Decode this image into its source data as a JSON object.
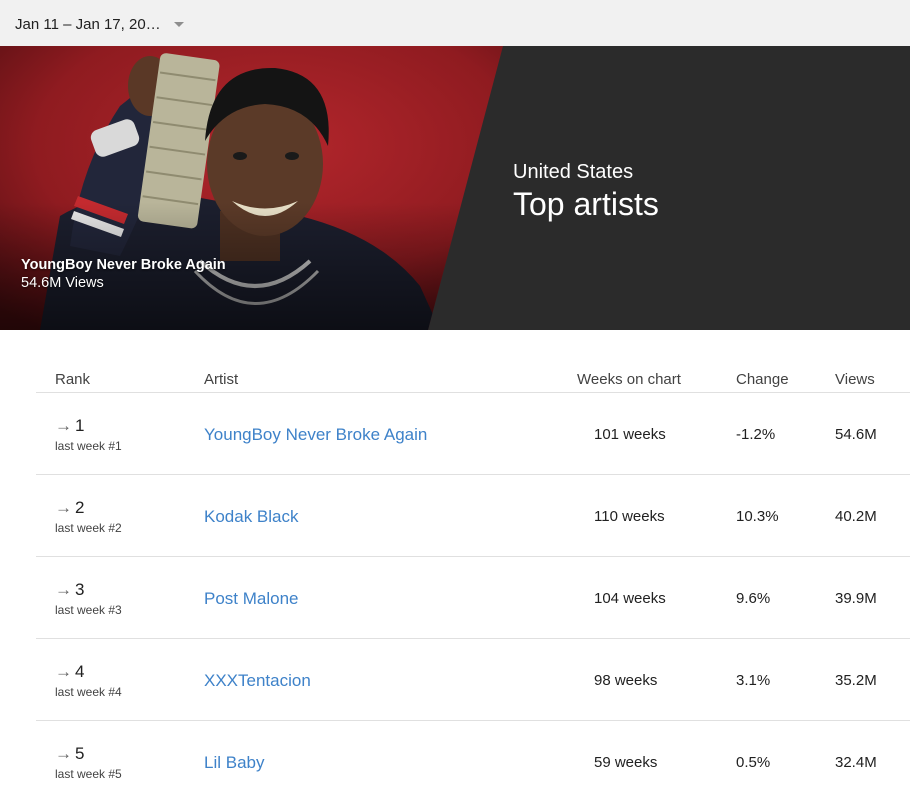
{
  "date_range": {
    "label": "Jan 11 – Jan 17, 20…"
  },
  "hero": {
    "artist": "YoungBoy Never Broke Again",
    "views": "54.6M Views",
    "country": "United States",
    "heading": "Top artists"
  },
  "columns": {
    "rank": "Rank",
    "artist": "Artist",
    "weeks": "Weeks on chart",
    "change": "Change",
    "views": "Views"
  },
  "rows": [
    {
      "arrow": "→",
      "rank": "1",
      "last_week": "last week #1",
      "artist": "YoungBoy Never Broke Again",
      "weeks": "101 weeks",
      "change": "-1.2%",
      "views": "54.6M"
    },
    {
      "arrow": "→",
      "rank": "2",
      "last_week": "last week #2",
      "artist": "Kodak Black",
      "weeks": "110 weeks",
      "change": "10.3%",
      "views": "40.2M"
    },
    {
      "arrow": "→",
      "rank": "3",
      "last_week": "last week #3",
      "artist": "Post Malone",
      "weeks": "104 weeks",
      "change": "9.6%",
      "views": "39.9M"
    },
    {
      "arrow": "→",
      "rank": "4",
      "last_week": "last week #4",
      "artist": "XXXTentacion",
      "weeks": "98 weeks",
      "change": "3.1%",
      "views": "35.2M"
    },
    {
      "arrow": "→",
      "rank": "5",
      "last_week": "last week #5",
      "artist": "Lil Baby",
      "weeks": "59 weeks",
      "change": "0.5%",
      "views": "32.4M"
    }
  ],
  "colors": {
    "link": "#3e82c9",
    "hero_dark": "#2b2b2b",
    "hero_red": "#8f1b20",
    "topbar": "#f1f1f1"
  },
  "icons": {
    "date_caret": "caret-down-icon",
    "rank_trend": "arrow-right-icon"
  }
}
